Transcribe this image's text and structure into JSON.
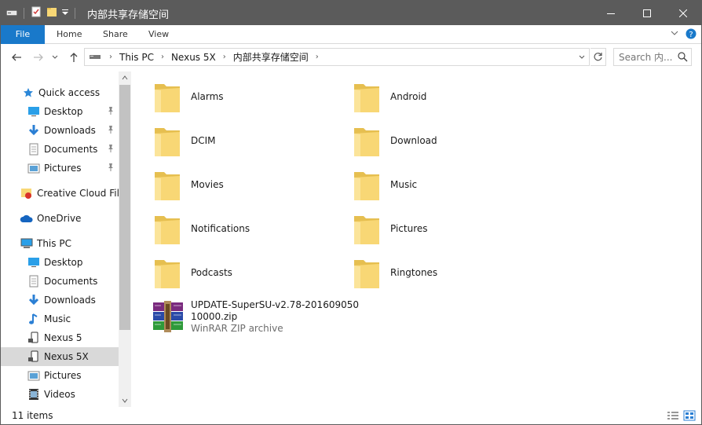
{
  "window": {
    "title": "内部共享存储空间",
    "quick_access_toolbar": [
      "drive-icon",
      "properties-icon",
      "new-folder-icon",
      "customize-dropdown-icon"
    ]
  },
  "ribbon": {
    "tabs": [
      {
        "label": "File",
        "active": true
      },
      {
        "label": "Home"
      },
      {
        "label": "Share"
      },
      {
        "label": "View"
      }
    ]
  },
  "address": {
    "breadcrumbs": [
      "This PC",
      "Nexus 5X",
      "内部共享存储空间"
    ]
  },
  "search": {
    "placeholder": "Search 内..."
  },
  "nav_pane": {
    "items": [
      {
        "label": "Quick access",
        "icon": "star-icon",
        "level": 0
      },
      {
        "label": "Desktop",
        "icon": "desktop-icon",
        "level": 1,
        "pinned": true
      },
      {
        "label": "Downloads",
        "icon": "download-icon",
        "level": 1,
        "pinned": true
      },
      {
        "label": "Documents",
        "icon": "documents-icon",
        "level": 1,
        "pinned": true
      },
      {
        "label": "Pictures",
        "icon": "pictures-icon",
        "level": 1,
        "pinned": true
      },
      {
        "label": "Creative Cloud Files",
        "icon": "creative-cloud-icon",
        "level": 0
      },
      {
        "label": "OneDrive",
        "icon": "onedrive-icon",
        "level": 0
      },
      {
        "label": "This PC",
        "icon": "computer-icon",
        "level": 0
      },
      {
        "label": "Desktop",
        "icon": "desktop-icon",
        "level": 1
      },
      {
        "label": "Documents",
        "icon": "documents-icon",
        "level": 1
      },
      {
        "label": "Downloads",
        "icon": "download-icon",
        "level": 1
      },
      {
        "label": "Music",
        "icon": "music-icon",
        "level": 1
      },
      {
        "label": "Nexus 5",
        "icon": "phone-icon",
        "level": 1
      },
      {
        "label": "Nexus 5X",
        "icon": "phone-icon",
        "level": 1,
        "selected": true
      },
      {
        "label": "Pictures",
        "icon": "pictures-icon",
        "level": 1
      },
      {
        "label": "Videos",
        "icon": "videos-icon",
        "level": 1
      }
    ]
  },
  "files": {
    "folders": [
      "Alarms",
      "Android",
      "DCIM",
      "Download",
      "Movies",
      "Music",
      "Notifications",
      "Pictures",
      "Podcasts",
      "Ringtones"
    ],
    "zip": {
      "name_line1": "UPDATE-SuperSU-v2.78-201609050",
      "name_line2": "10000.zip",
      "type": "WinRAR ZIP archive"
    }
  },
  "status": {
    "count": "11 items"
  },
  "colors": {
    "titlebar": "#5b5b5b",
    "file_tab": "#1979ca",
    "folder": "#f8d775",
    "selection": "#d9d9d9"
  }
}
